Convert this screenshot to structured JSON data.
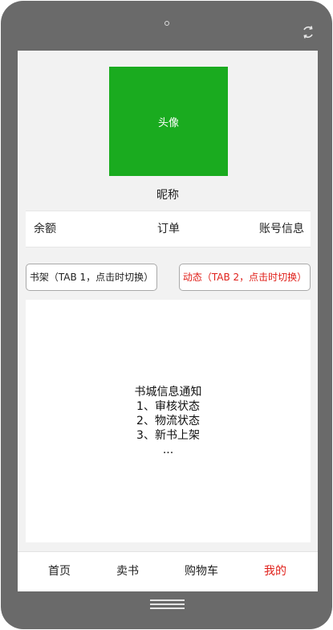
{
  "profile": {
    "avatar_label": "头像",
    "nickname": "昵称"
  },
  "info_row": {
    "balance": "余额",
    "orders": "订单",
    "account_info": "账号信息"
  },
  "tabs": [
    {
      "label": "书架（TAB 1，点击时切换）",
      "active": false
    },
    {
      "label": "动态（TAB 2，点击时切换）",
      "active": true
    }
  ],
  "content": {
    "lines": [
      "书城信息通知",
      "1、审核状态",
      "2、物流状态",
      "3、新书上架",
      "..."
    ]
  },
  "bottom_nav": [
    {
      "label": "首页",
      "active": false
    },
    {
      "label": "卖书",
      "active": false
    },
    {
      "label": "购物车",
      "active": false
    },
    {
      "label": "我的",
      "active": true
    }
  ],
  "colors": {
    "phone_frame": "#6a6a6a",
    "screen_bg": "#f2f2f2",
    "avatar_bg": "#1aab1f",
    "accent_red": "#e0201a"
  }
}
